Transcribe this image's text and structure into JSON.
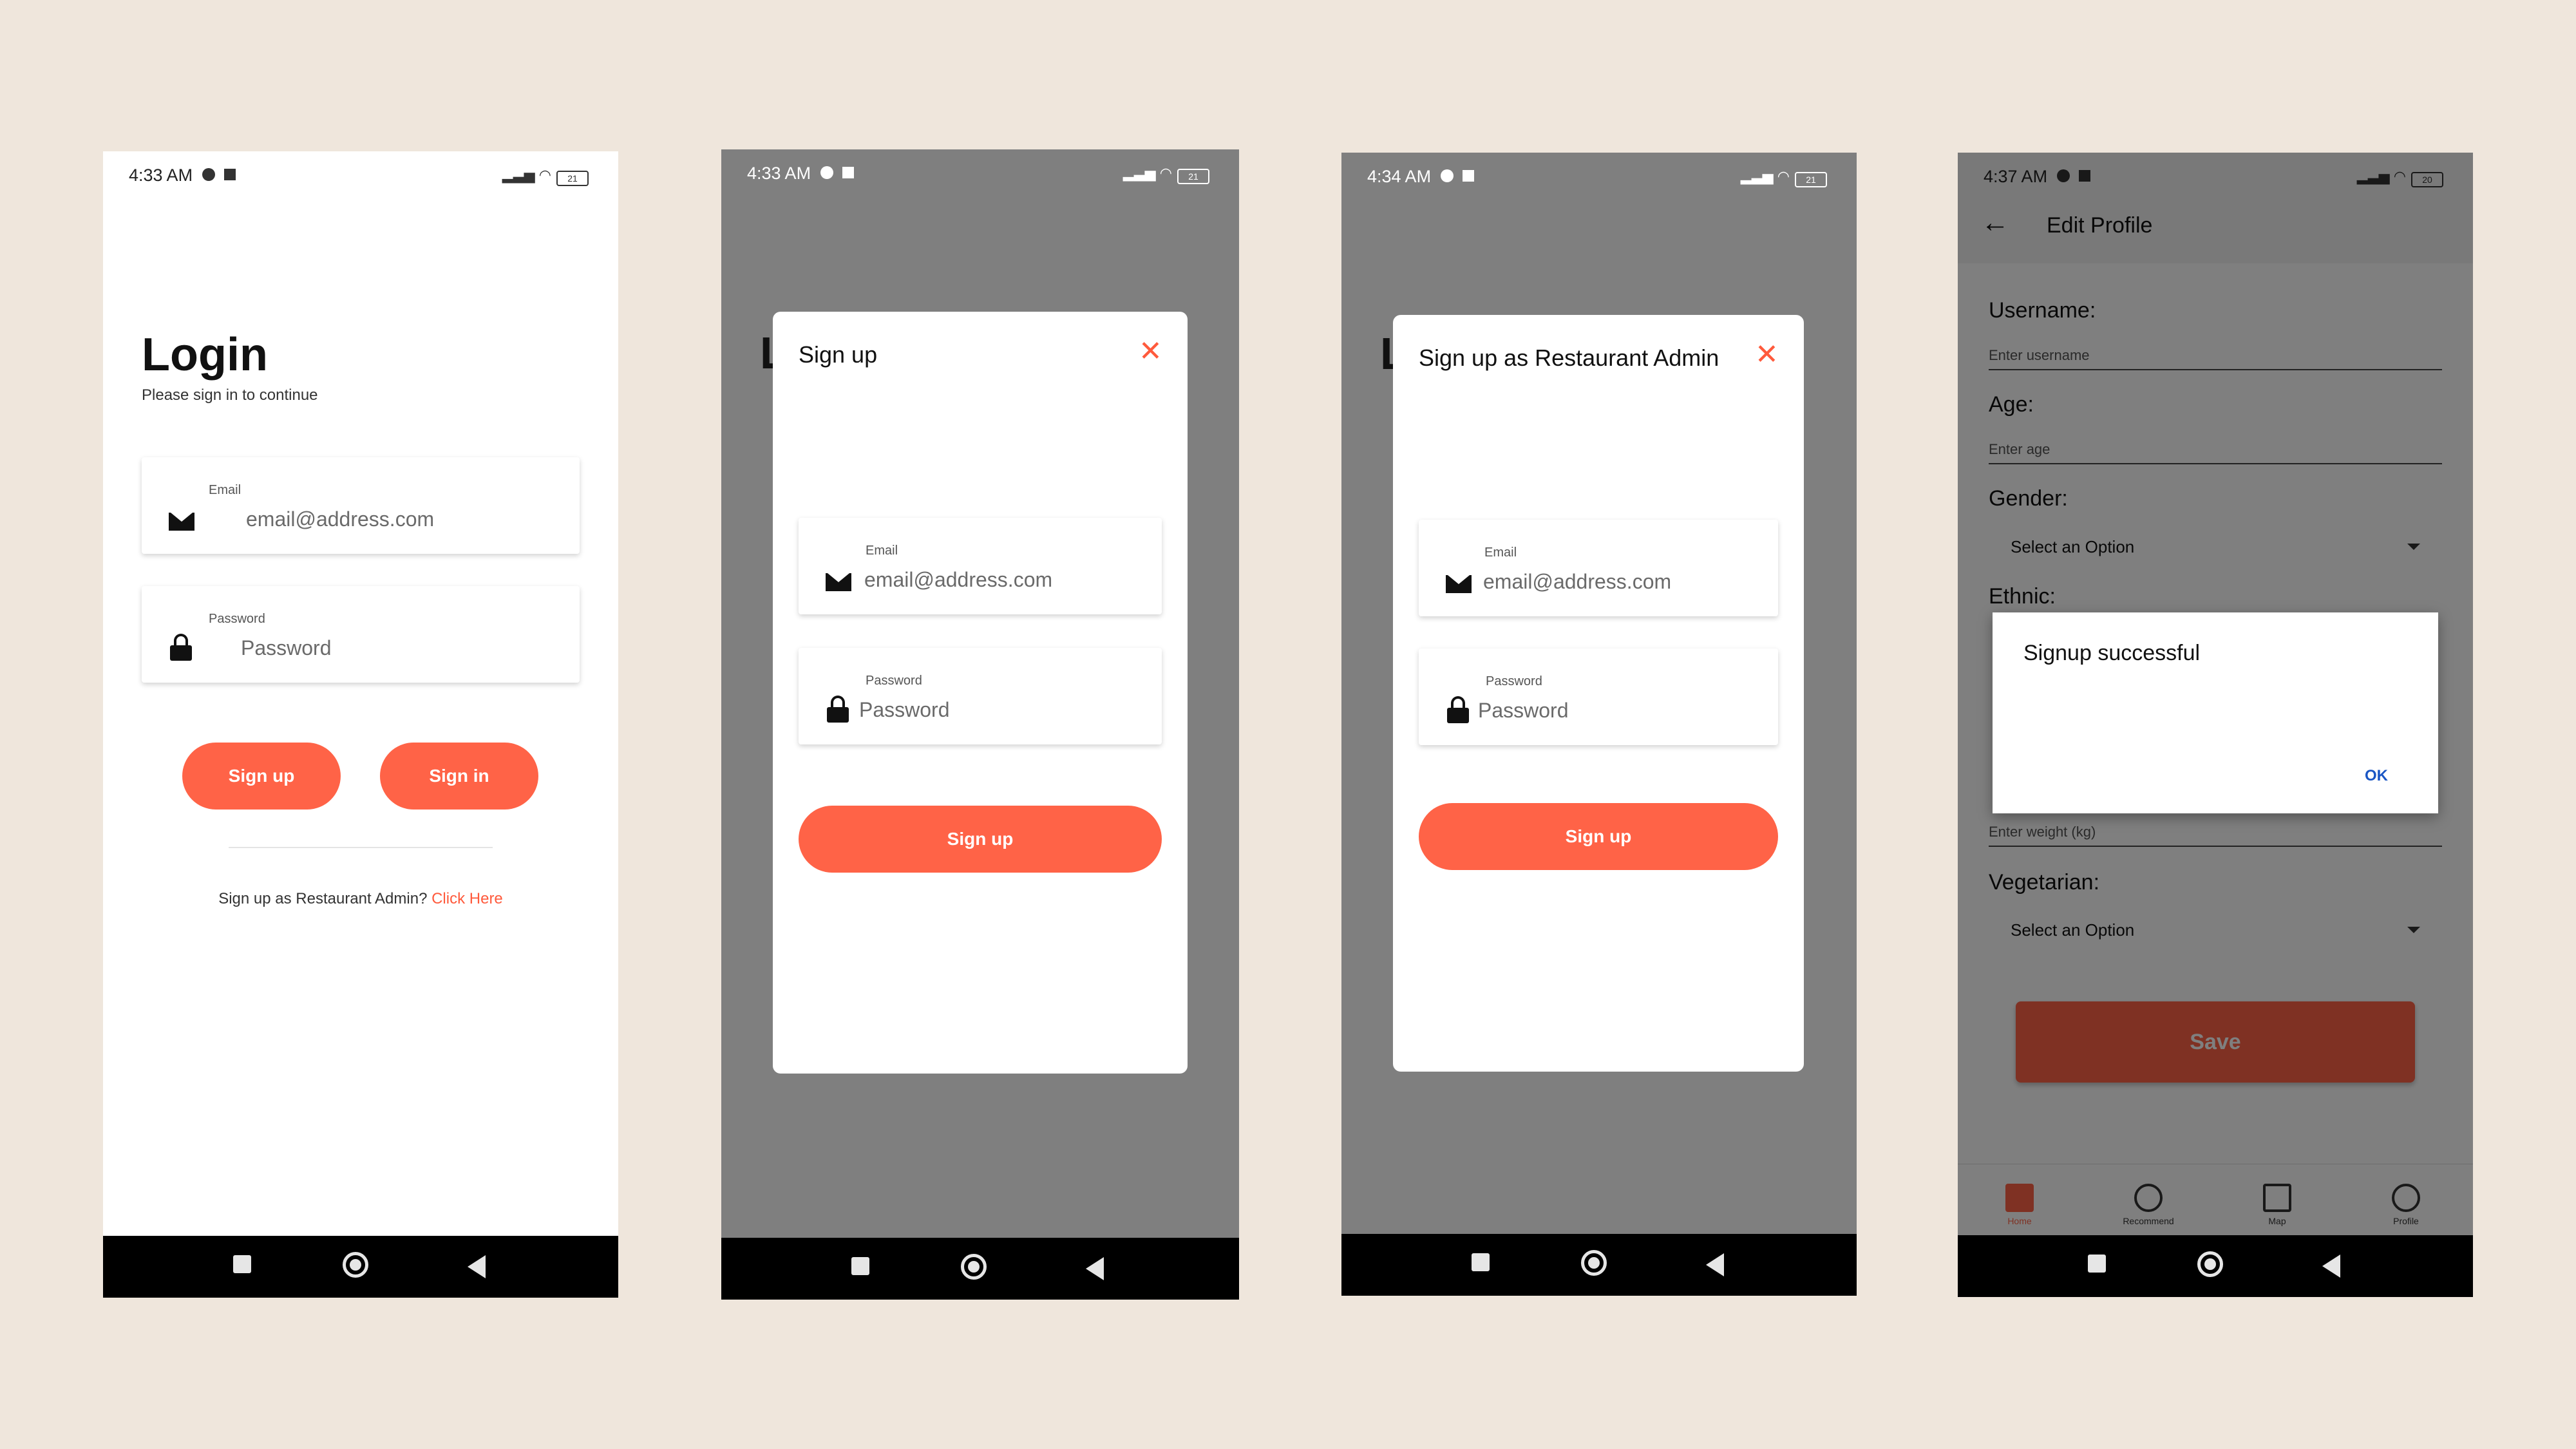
{
  "screens": {
    "login": {
      "time": "4:33 AM",
      "battery": "21",
      "title": "Login",
      "subtitle": "Please sign in to continue",
      "email_label": "Email",
      "email_placeholder": "email@address.com",
      "password_label": "Password",
      "password_placeholder": "Password",
      "signup_button": "Sign up",
      "signin_button": "Sign in",
      "admin_prompt": "Sign up as Restaurant Admin?",
      "admin_link": "Click Here"
    },
    "signup": {
      "time": "4:33 AM",
      "battery": "21",
      "title": "Sign up",
      "close": "✕",
      "email_label": "Email",
      "email_placeholder": "email@address.com",
      "password_label": "Password",
      "password_placeholder": "Password",
      "button": "Sign up"
    },
    "admin_signup": {
      "time": "4:34 AM",
      "battery": "21",
      "title": "Sign up as Restaurant Admin",
      "close": "✕",
      "email_label": "Email",
      "email_placeholder": "email@address.com",
      "password_label": "Password",
      "password_placeholder": "Password",
      "button": "Sign up"
    },
    "edit_profile": {
      "time": "4:37 AM",
      "battery": "20",
      "title": "Edit Profile",
      "username_label": "Username:",
      "username_placeholder": "Enter username",
      "age_label": "Age:",
      "age_placeholder": "Enter age",
      "gender_label": "Gender:",
      "gender_select": "Select an Option",
      "ethnic_label": "Ethnic:",
      "weight_placeholder": "Enter weight (kg)",
      "vegetarian_label": "Vegetarian:",
      "vegetarian_select": "Select an Option",
      "save_button": "Save",
      "dialog_message": "Signup successful",
      "dialog_ok": "OK",
      "tabs": [
        "Home",
        "Recommend",
        "Map",
        "Profile"
      ]
    }
  },
  "colors": {
    "accent": "#ff6347",
    "background": "#efe6dc",
    "overlay": "#7f7f7f"
  }
}
